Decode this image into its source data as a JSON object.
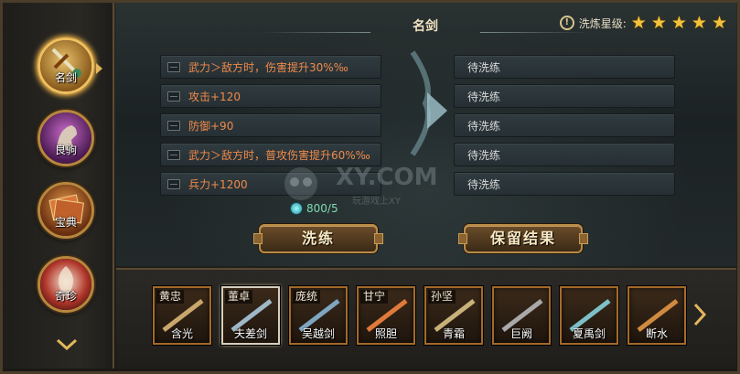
{
  "categories": [
    {
      "label": "名剑",
      "icon": "sword-icon",
      "active": true
    },
    {
      "label": "良驹",
      "icon": "horse-icon",
      "active": false
    },
    {
      "label": "宝典",
      "icon": "book-icon",
      "active": false
    },
    {
      "label": "奇珍",
      "icon": "feather-icon",
      "active": false
    }
  ],
  "panel": {
    "title": "名剑",
    "star_label": "洗炼星级:",
    "stars": 5
  },
  "current_attrs": [
    "武力＞敌方时，伤害提升30%‰",
    "攻击+120",
    "防御+90",
    "武力＞敌方时，普攻伤害提升60%‰",
    "兵力+1200"
  ],
  "result_attrs": [
    "待洗练",
    "待洗练",
    "待洗练",
    "待洗练",
    "待洗练"
  ],
  "cost": "800/5",
  "watermark": "XY.COM",
  "watermark_sub": "玩游戏上XY",
  "buttons": {
    "refine": "洗练",
    "keep": "保留结果"
  },
  "heroes": [
    {
      "hero": "黄忠",
      "weapon": "含光",
      "color": "#c9a66b"
    },
    {
      "hero": "董卓",
      "weapon": "夫差剑",
      "color": "#9fb8c8"
    },
    {
      "hero": "庞统",
      "weapon": "吴越剑",
      "color": "#7fa6c0"
    },
    {
      "hero": "甘宁",
      "weapon": "照胆",
      "color": "#e07a3a"
    },
    {
      "hero": "孙坚",
      "weapon": "青霜",
      "color": "#c8b27a"
    },
    {
      "hero": "",
      "weapon": "巨阙",
      "color": "#a9a9a9"
    },
    {
      "hero": "",
      "weapon": "夏禹剑",
      "color": "#7ec0c8"
    },
    {
      "hero": "",
      "weapon": "断水",
      "color": "#d08a40"
    }
  ]
}
